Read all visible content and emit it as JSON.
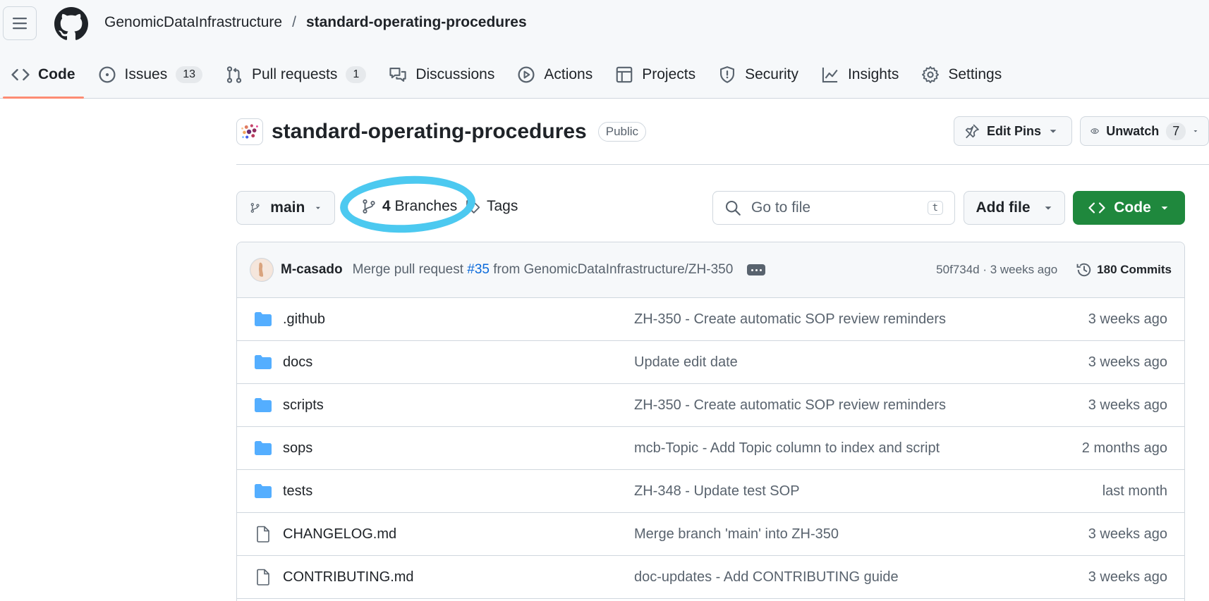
{
  "header": {
    "owner": "GenomicDataInfrastructure",
    "separator": "/",
    "repo": "standard-operating-procedures"
  },
  "tabs": [
    {
      "label": "Code",
      "icon": "code-icon",
      "selected": true
    },
    {
      "label": "Issues",
      "icon": "issue-opened-icon",
      "count": "13"
    },
    {
      "label": "Pull requests",
      "icon": "git-pull-request-icon",
      "count": "1"
    },
    {
      "label": "Discussions",
      "icon": "comment-discussion-icon"
    },
    {
      "label": "Actions",
      "icon": "play-icon"
    },
    {
      "label": "Projects",
      "icon": "table-icon"
    },
    {
      "label": "Security",
      "icon": "shield-icon"
    },
    {
      "label": "Insights",
      "icon": "graph-icon"
    },
    {
      "label": "Settings",
      "icon": "gear-icon"
    }
  ],
  "repo_header": {
    "name": "standard-operating-procedures",
    "visibility": "Public",
    "edit_pins": "Edit Pins",
    "unwatch": "Unwatch",
    "watch_count": "7"
  },
  "toolbar": {
    "branch": "main",
    "branches_count": "4",
    "branches_label": "Branches",
    "tags_label": "Tags",
    "search_placeholder": "Go to file",
    "search_shortcut": "t",
    "add_file": "Add file",
    "code": "Code"
  },
  "latest_commit": {
    "author": "M-casado",
    "message_prefix": "Merge pull request",
    "pr": "#35",
    "message_suffix": "from GenomicDataInfrastructure/ZH-350",
    "hash_time": "50f734d · 3 weeks ago",
    "commits": "180 Commits"
  },
  "files": [
    {
      "name": ".github",
      "type": "folder",
      "message": "ZH-350 - Create automatic SOP review reminders",
      "age": "3 weeks ago"
    },
    {
      "name": "docs",
      "type": "folder",
      "message": "Update edit date",
      "age": "3 weeks ago"
    },
    {
      "name": "scripts",
      "type": "folder",
      "message": "ZH-350 - Create automatic SOP review reminders",
      "age": "3 weeks ago"
    },
    {
      "name": "sops",
      "type": "folder",
      "message": "mcb-Topic - Add Topic column to index and script",
      "age": "2 months ago"
    },
    {
      "name": "tests",
      "type": "folder",
      "message": "ZH-348 - Update test SOP",
      "age": "last month"
    },
    {
      "name": "CHANGELOG.md",
      "type": "file",
      "message": "Merge branch 'main' into ZH-350",
      "age": "3 weeks ago"
    },
    {
      "name": "CONTRIBUTING.md",
      "type": "file",
      "message": "doc-updates - Add CONTRIBUTING guide",
      "age": "3 weeks ago"
    }
  ],
  "colors": {
    "accent_green": "#1f883d",
    "link_blue": "#0969da",
    "folder_blue": "#54aeff",
    "tab_underline": "#fd8c73",
    "annotation_cyan": "#4cc9f0"
  }
}
